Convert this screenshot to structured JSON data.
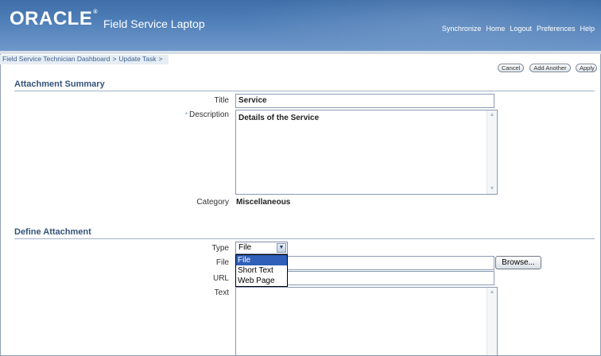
{
  "header": {
    "logo": "ORACLE",
    "logo_mark": "®",
    "app_title": "Field Service Laptop",
    "global_links": [
      "Synchronize",
      "Home",
      "Logout",
      "Preferences",
      "Help"
    ]
  },
  "breadcrumb": {
    "items": [
      "Field Service Technician Dashboard",
      "Update Task"
    ],
    "separator": ">"
  },
  "actions": {
    "cancel": "Cancel",
    "add_another": "Add Another",
    "apply": "Apply"
  },
  "attachment_summary": {
    "heading": "Attachment Summary",
    "title_label": "Title",
    "title_value": "Service",
    "required_marker": "*",
    "description_label": "Description",
    "description_value": "Details of the Service",
    "category_label": "Category",
    "category_value": "Miscellaneous"
  },
  "define_attachment": {
    "heading": "Define Attachment",
    "type_label": "Type",
    "type_selected": "File",
    "type_options": [
      "File",
      "Short Text",
      "Web Page"
    ],
    "file_label": "File",
    "file_value": "",
    "browse_label": "Browse...",
    "url_label": "URL",
    "url_value": "",
    "text_label": "Text",
    "text_value": ""
  },
  "icons": {
    "scroll_up": "▲",
    "scroll_down": "▼",
    "select_arrow": "▼"
  },
  "colors": {
    "banner": "#4c7cb6",
    "section_heading": "#34537a",
    "selected_option": "#2f5fb8"
  }
}
